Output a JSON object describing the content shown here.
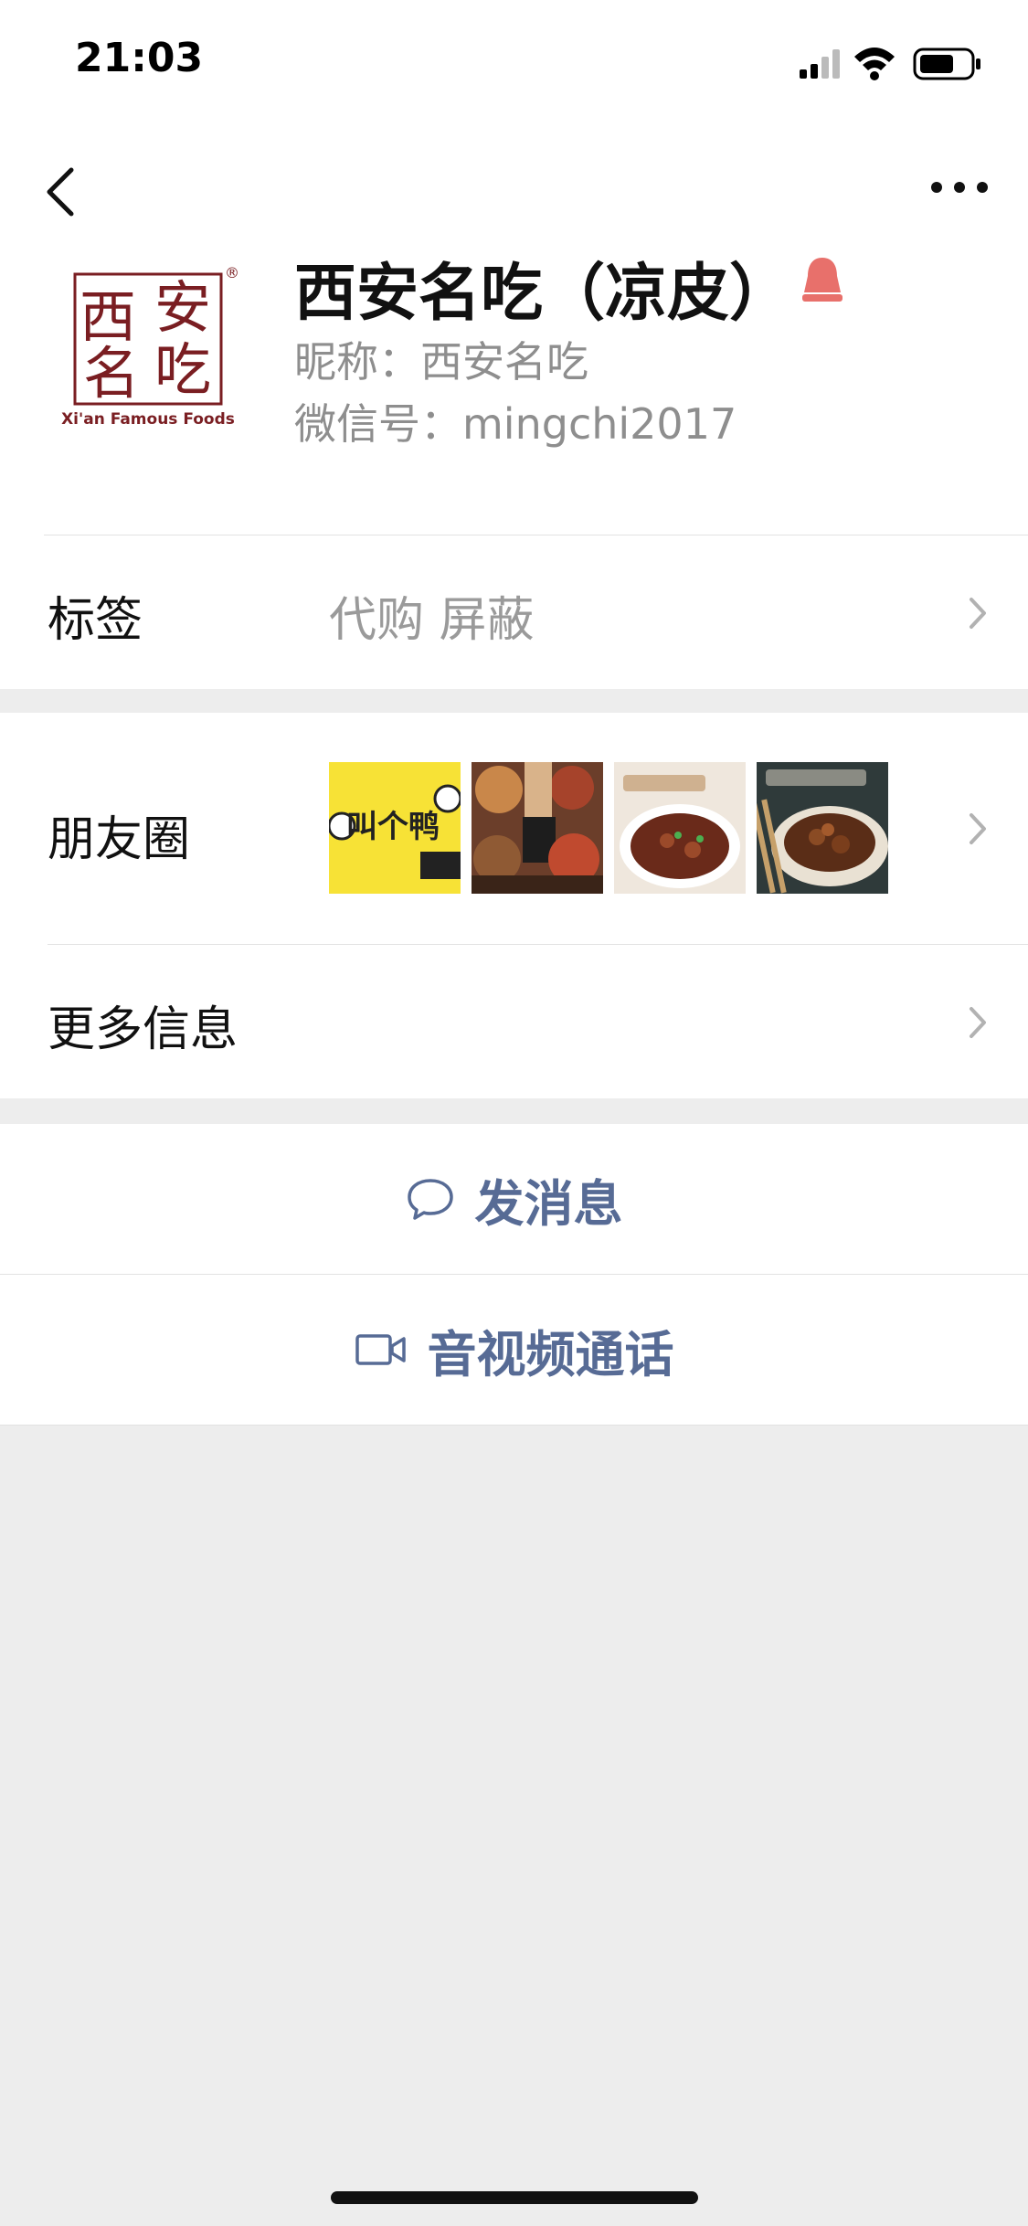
{
  "status": {
    "time": "21:03"
  },
  "profile": {
    "display_name": "西安名吃（凉皮）",
    "nickname_label": "昵称：",
    "nickname": "西安名吃",
    "wechat_id_label": "微信号：",
    "wechat_id": "mingchi2017",
    "logo": {
      "chars": [
        "西",
        "安",
        "名",
        "吃"
      ],
      "subtitle": "Xi'an Famous Foods",
      "mark": "®",
      "color": "#7a1e22"
    }
  },
  "tags": {
    "label": "标签",
    "value": "代购 屏蔽"
  },
  "moments": {
    "label": "朋友圈",
    "thumb1_text": "叫个鸭"
  },
  "more_info": {
    "label": "更多信息"
  },
  "actions": {
    "message": "发消息",
    "call": "音视频通话"
  },
  "colors": {
    "link": "#576b95",
    "gender": "#e8706b",
    "bg": "#ededed"
  }
}
